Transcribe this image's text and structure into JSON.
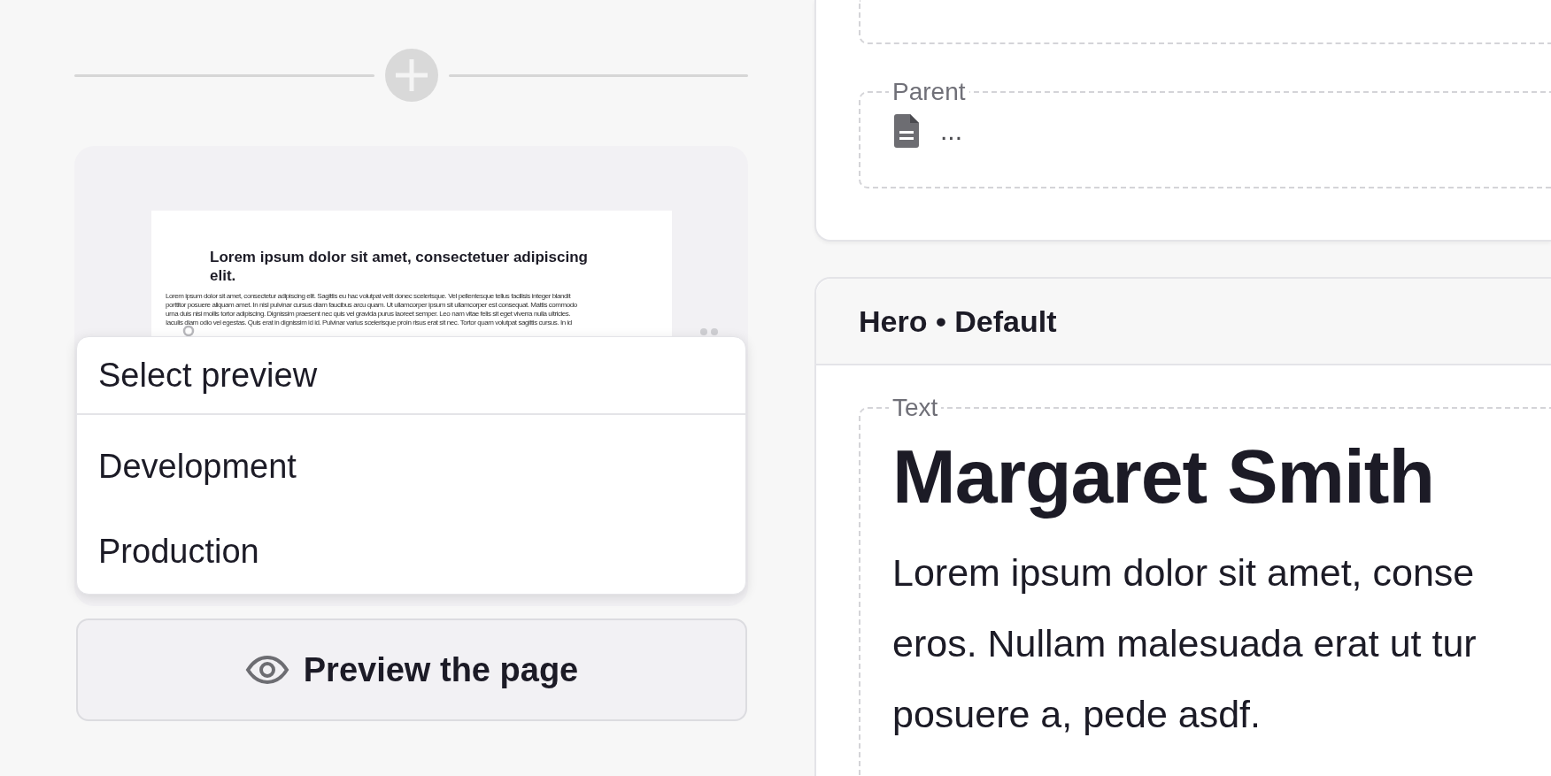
{
  "thumbnail": {
    "heading": "Lorem ipsum dolor sit amet, consectetuer adipiscing elit.",
    "body_lines": [
      "Lorem ipsum dolor sit amet, consectetur adipiscing elit. Sagittis eu hac volutpat velit donec scelerisque. Vel pellentesque tellus facilisis integer blandit",
      "porttitor posuere aliquam amet. In nisl pulvinar cursus diam faucibus arcu quam. Ut ullamcorper ipsum sit ullamcorper est consequat. Mattis commodo",
      "urna duis nisi mollis tortor adipiscing. Dignissim praesent nec quis vel gravida purus laoreet semper. Leo nam vitae felis sit eget viverra nulla ultricies.",
      "Iaculis diam odio vel egestas. Quis erat in dignissim id id. Pulvinar varius scelerisque proin risus erat sit nec. Tortor quam volutpat sagittis cursus. In id"
    ]
  },
  "preview_menu": {
    "title": "Select preview",
    "options": [
      "Development",
      "Production"
    ]
  },
  "preview_button": {
    "label": "Preview the page"
  },
  "parent_field": {
    "legend": "Parent",
    "value": "..."
  },
  "block": {
    "title": "Hero • Default",
    "text_field": {
      "legend": "Text",
      "heading": "Margaret Smith",
      "paragraph_lines": [
        "Lorem ipsum dolor sit amet, conse",
        "eros. Nullam malesuada erat ut tur",
        "posuere a, pede asdf."
      ]
    }
  }
}
